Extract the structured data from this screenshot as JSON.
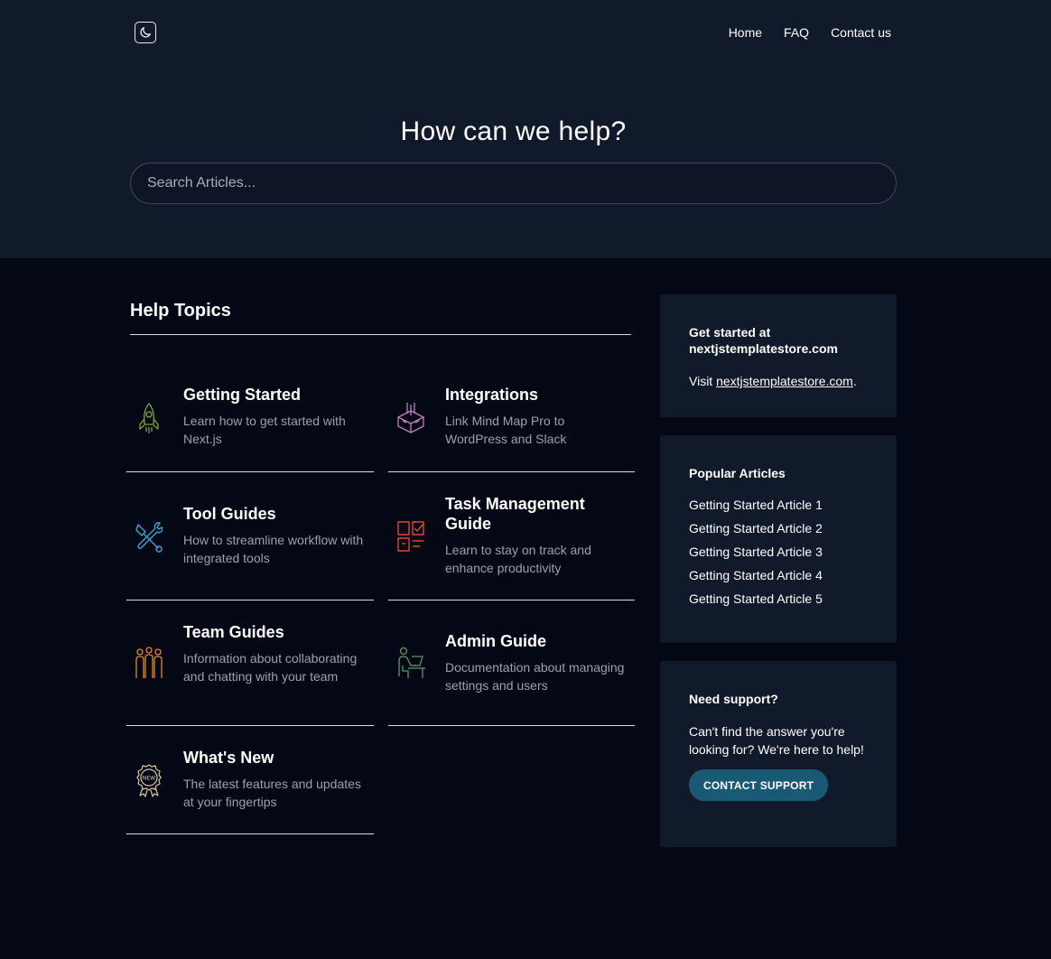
{
  "nav": {
    "theme_icon": "moon-icon",
    "links": [
      "Home",
      "FAQ",
      "Contact us"
    ]
  },
  "hero": {
    "title": "How can we help?",
    "search_placeholder": "Search Articles..."
  },
  "topics": {
    "heading": "Help Topics",
    "items": [
      {
        "title": "Getting Started",
        "desc": "Learn how to get started with Next.js",
        "icon": "rocket-icon",
        "color": "#7aa83c"
      },
      {
        "title": "Integrations",
        "desc": "Link Mind Map Pro to WordPress and Slack",
        "icon": "box-plugin-icon",
        "color": "#c77dbd"
      },
      {
        "title": "Tool Guides",
        "desc": "How to streamline workflow with integrated tools",
        "icon": "tools-icon",
        "color": "#3aa3d6"
      },
      {
        "title": "Task Management Guide",
        "desc": "Learn to stay on track and enhance productivity",
        "icon": "task-checklist-icon",
        "color": "#e0453a"
      },
      {
        "title": "Team Guides",
        "desc": "Information about collaborating and chatting with your team",
        "icon": "team-icon",
        "color": "#e08a2e"
      },
      {
        "title": "Admin Guide",
        "desc": "Documentation about managing settings and users",
        "icon": "admin-desk-icon",
        "color": "#5f9a6a"
      },
      {
        "title": "What's New",
        "desc": "The latest features and updates at your fingertips",
        "icon": "new-badge-icon",
        "color": "#d9c9a3"
      }
    ]
  },
  "sidebar": {
    "get_started": {
      "title": "Get started at nextjstemplatestore.com",
      "visit_prefix": "Visit ",
      "link": "nextjstemplatestore.com",
      "suffix": "."
    },
    "popular": {
      "title": "Popular Articles",
      "articles": [
        "Getting Started Article 1",
        "Getting Started Article 2",
        "Getting Started Article 3",
        "Getting Started Article 4",
        "Getting Started Article 5"
      ]
    },
    "support": {
      "title": "Need support?",
      "text": "Can't find the answer you're looking for? We're here to help!",
      "button": "CONTACT SUPPORT"
    }
  }
}
